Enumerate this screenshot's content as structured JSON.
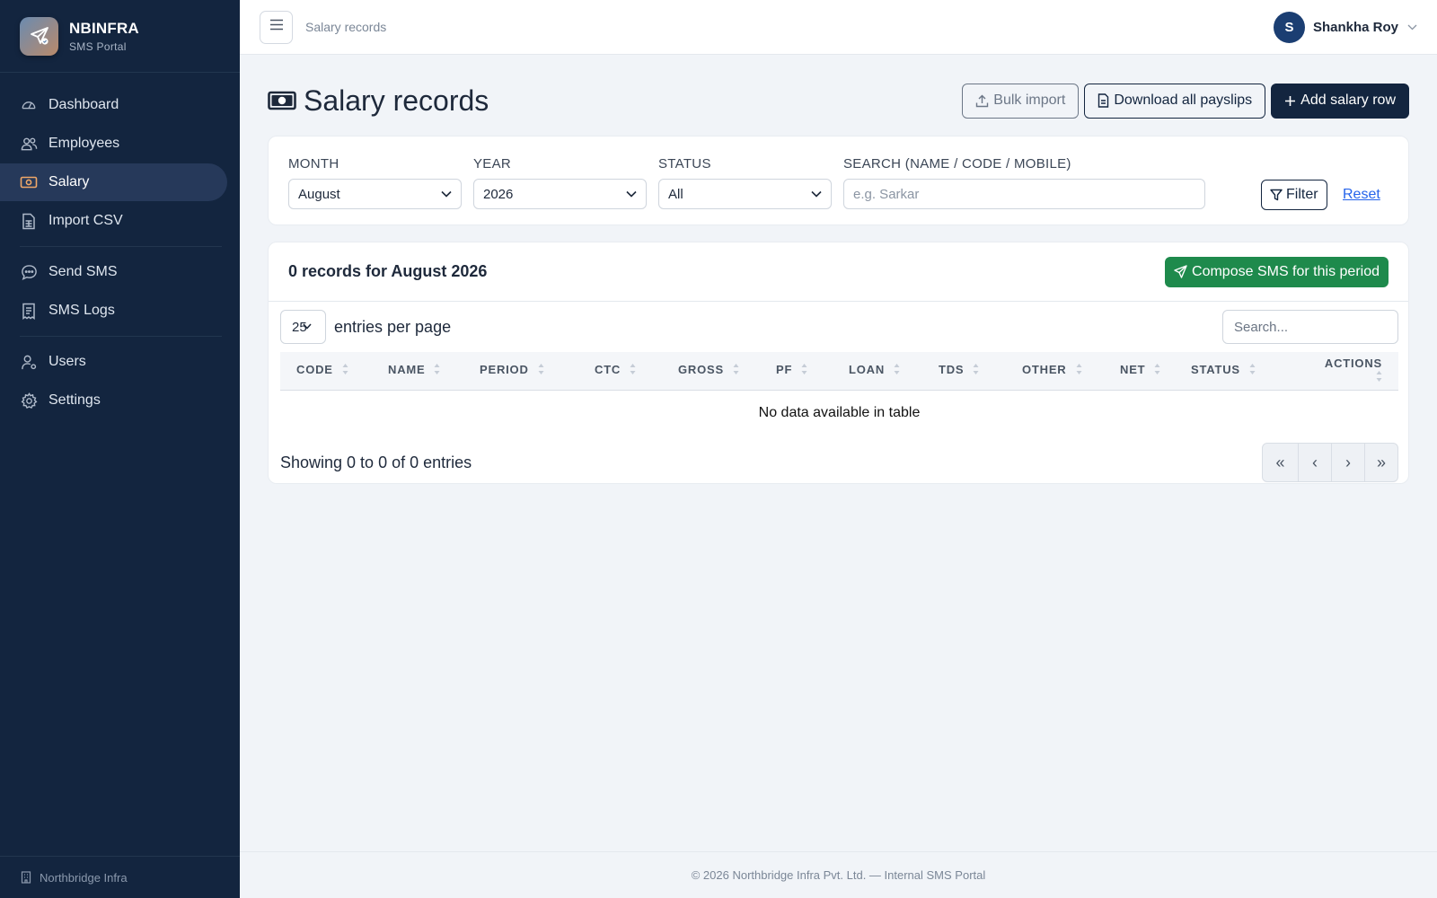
{
  "brand": {
    "name": "NBINFRA",
    "subtitle": "SMS Portal"
  },
  "sidebar": {
    "items": [
      {
        "label": "Dashboard",
        "icon": "dashboard-icon"
      },
      {
        "label": "Employees",
        "icon": "users-icon"
      },
      {
        "label": "Salary",
        "icon": "cash-icon",
        "active": true
      },
      {
        "label": "Import CSV",
        "icon": "file-spreadsheet-icon"
      },
      {
        "label": "Send SMS",
        "icon": "chat-dots-icon"
      },
      {
        "label": "SMS Logs",
        "icon": "receipt-icon"
      },
      {
        "label": "Users",
        "icon": "person-gear-icon"
      },
      {
        "label": "Settings",
        "icon": "gear-icon"
      }
    ],
    "footer": "Northbridge Infra"
  },
  "topbar": {
    "breadcrumb": "Salary records",
    "user_initial": "S",
    "user_name": "Shankha Roy"
  },
  "page": {
    "title": "Salary records",
    "actions": {
      "bulk_import": "Bulk import",
      "download_payslips": "Download all payslips",
      "add_row": "Add salary row"
    }
  },
  "filters": {
    "month": {
      "label": "MONTH",
      "value": "August"
    },
    "year": {
      "label": "YEAR",
      "value": "2026"
    },
    "status": {
      "label": "STATUS",
      "value": "All"
    },
    "search": {
      "label": "SEARCH (NAME / CODE / MOBILE)",
      "placeholder": "e.g. Sarkar",
      "value": ""
    },
    "filter_button": "Filter",
    "reset_link": "Reset"
  },
  "records": {
    "title": "0 records for August 2026",
    "compose_button": "Compose SMS for this period",
    "page_length": "25",
    "page_length_label": "entries per page",
    "search_placeholder": "Search...",
    "columns": [
      "CODE",
      "NAME",
      "PERIOD",
      "CTC",
      "GROSS",
      "PF",
      "LOAN",
      "TDS",
      "OTHER",
      "NET",
      "STATUS",
      "ACTIONS"
    ],
    "empty_text": "No data available in table",
    "info": "Showing 0 to 0 of 0 entries",
    "pager": {
      "first": "«",
      "prev": "‹",
      "next": "›",
      "last": "»"
    }
  },
  "footer": "© 2026 Northbridge Infra Pvt. Ltd. — Internal SMS Portal",
  "colors": {
    "sidebar": "#13253f",
    "primary": "#13253f",
    "success": "#1e8a4c",
    "link": "#2563eb",
    "accent_icon": "#f0a868"
  }
}
